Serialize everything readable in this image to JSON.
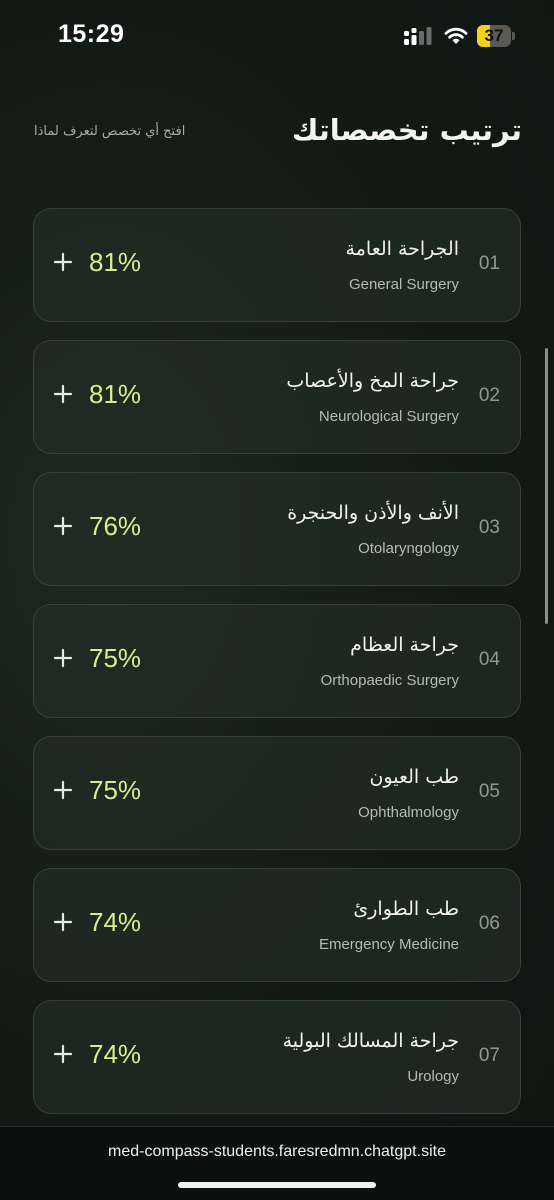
{
  "status_bar": {
    "time": "15:29",
    "battery_level": "37",
    "battery_fraction": 0.37
  },
  "header": {
    "title": "ترتيب تخصصاتك",
    "subtitle": "افتح أي تخصص لتعرف لماذا"
  },
  "specialties": [
    {
      "rank": "01",
      "name_ar": "الجراحة العامة",
      "name_en": "General Surgery",
      "percent": "81%"
    },
    {
      "rank": "02",
      "name_ar": "جراحة المخ والأعصاب",
      "name_en": "Neurological Surgery",
      "percent": "81%"
    },
    {
      "rank": "03",
      "name_ar": "الأنف والأذن والحنجرة",
      "name_en": "Otolaryngology",
      "percent": "76%"
    },
    {
      "rank": "04",
      "name_ar": "جراحة العظام",
      "name_en": "Orthopaedic Surgery",
      "percent": "75%"
    },
    {
      "rank": "05",
      "name_ar": "طب العيون",
      "name_en": "Ophthalmology",
      "percent": "75%"
    },
    {
      "rank": "06",
      "name_ar": "طب الطوارئ",
      "name_en": "Emergency Medicine",
      "percent": "74%"
    },
    {
      "rank": "07",
      "name_ar": "جراحة المسالك البولية",
      "name_en": "Urology",
      "percent": "74%"
    }
  ],
  "icons": {
    "expand": "plus-icon",
    "signal": "cellular-signal-icon",
    "wifi": "wifi-icon",
    "battery": "battery-icon"
  },
  "colors": {
    "accent": "#d3ef8e",
    "background": "#141c17",
    "card_border": "#36413a",
    "battery": "#f3d21d"
  },
  "browser": {
    "url": "med-compass-students.faresredmn.chatgpt.site"
  }
}
